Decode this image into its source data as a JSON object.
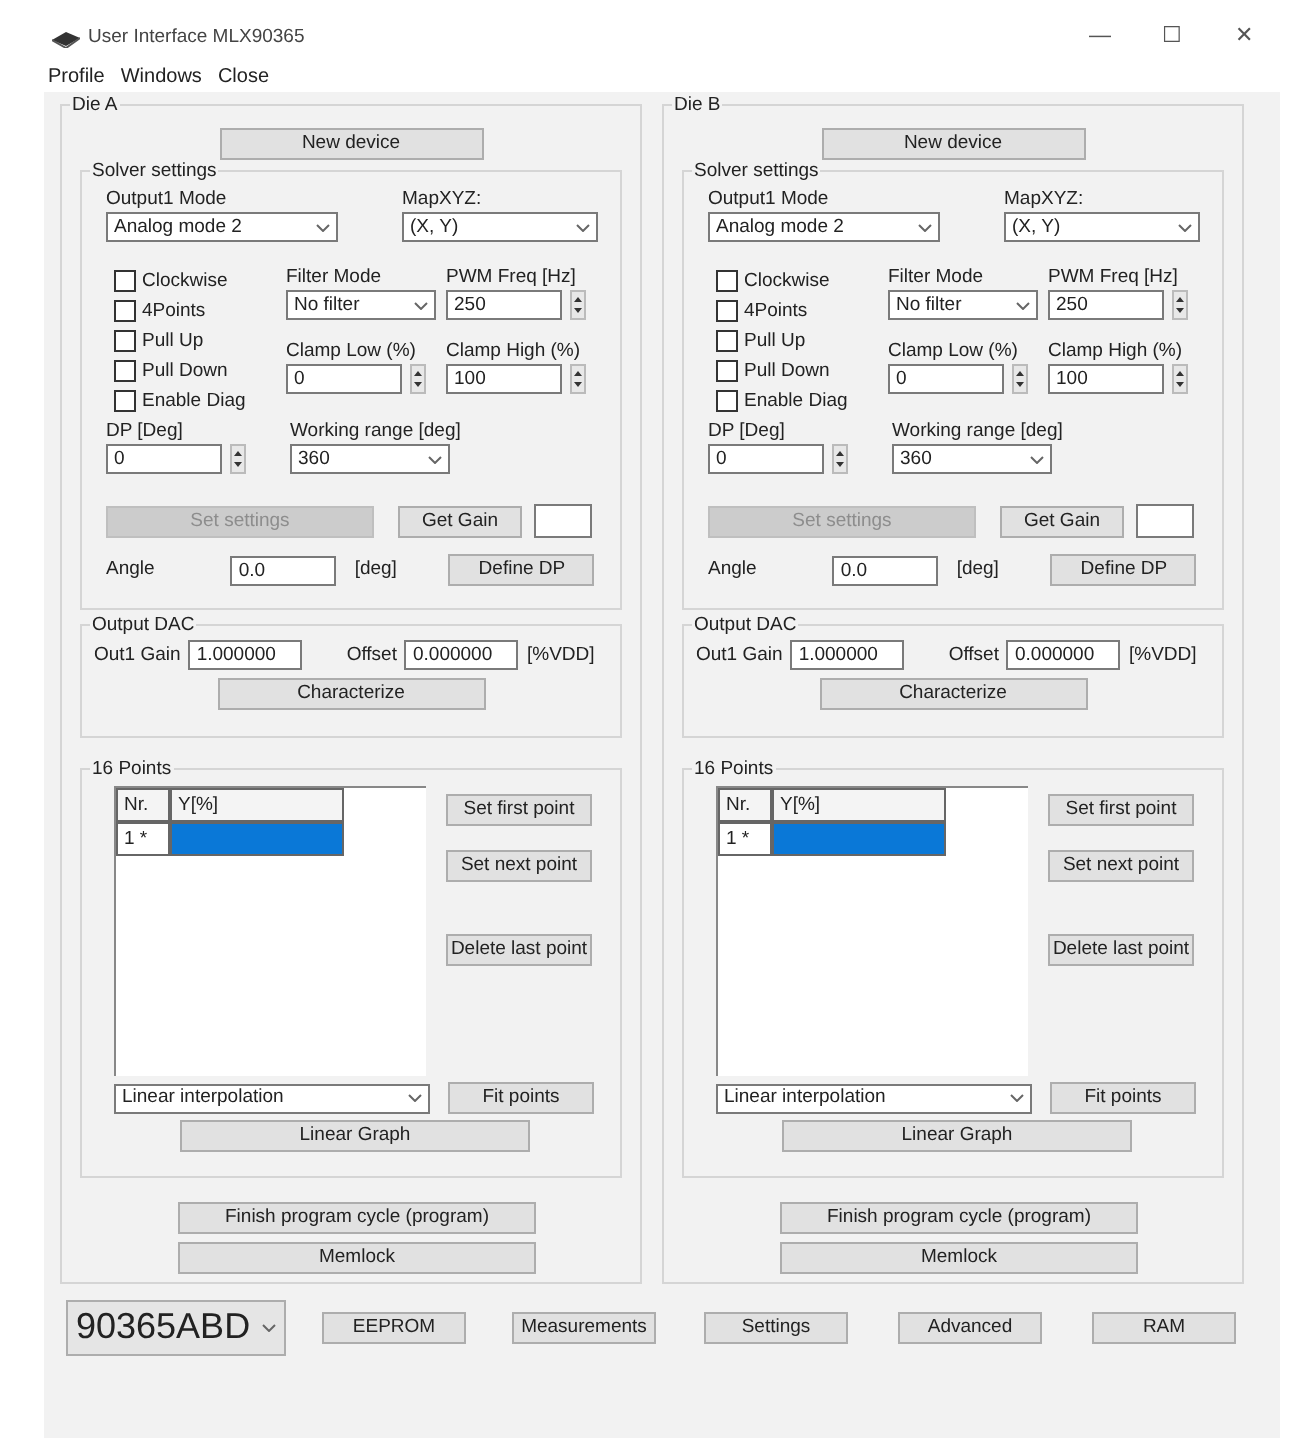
{
  "window": {
    "title": "User Interface MLX90365",
    "controls": [
      "—",
      "☐",
      "✕"
    ]
  },
  "menu": [
    {
      "label": "Profile"
    },
    {
      "label": "Windows"
    },
    {
      "label": "Close"
    }
  ],
  "panels": [
    {
      "title": "Die A",
      "new_device": "New device",
      "solver": {
        "title": "Solver settings",
        "output_mode": {
          "label": "Output1 Mode",
          "value": "Analog mode 2"
        },
        "map": {
          "label": "MapXYZ:",
          "value": "(X, Y)"
        },
        "checkboxes": [
          {
            "label": "Clockwise",
            "checked": false
          },
          {
            "label": "4Points",
            "checked": false
          },
          {
            "label": "Pull Up",
            "checked": false
          },
          {
            "label": "Pull Down",
            "checked": false
          },
          {
            "label": "Enable Diag",
            "checked": false
          }
        ],
        "filter": {
          "label": "Filter Mode",
          "value": "No filter"
        },
        "pwm": {
          "label": "PWM Freq [Hz]",
          "value": "250"
        },
        "clamp_low": {
          "label": "Clamp Low (%)",
          "value": "0"
        },
        "clamp_high": {
          "label": "Clamp High (%)",
          "value": "100"
        },
        "dp": {
          "label": "DP [Deg]",
          "value": "0"
        },
        "working_range": {
          "label": "Working range [deg]",
          "value": "360"
        },
        "set_settings": {
          "label": "Set settings",
          "disabled": true
        },
        "get_gain": "Get Gain",
        "angle": {
          "label": "Angle",
          "value": "0.0",
          "unit": "[deg]"
        },
        "define_dp": "Define DP"
      },
      "output_dac": {
        "title": "Output DAC",
        "gain": {
          "label": "Out1 Gain",
          "value": "1.000000"
        },
        "offset": {
          "label": "Offset",
          "value": "0.000000"
        },
        "unit": "[%VDD]",
        "characterize": "Characterize"
      },
      "points": {
        "title": "16 Points",
        "columns": [
          "Nr.",
          "Y[%]"
        ],
        "rows": [
          {
            "nr": "1 *",
            "selected": true
          }
        ],
        "buttons": [
          "Set first point",
          "Set next point",
          "Delete last point"
        ],
        "interpolation": "Linear interpolation",
        "fit": "Fit points",
        "graph": "Linear Graph"
      },
      "finish": "Finish program cycle (program)",
      "memlock": "Memlock"
    },
    {
      "title": "Die B",
      "new_device": "New device",
      "solver": {
        "title": "Solver settings",
        "output_mode": {
          "label": "Output1 Mode",
          "value": "Analog mode 2"
        },
        "map": {
          "label": "MapXYZ:",
          "value": "(X, Y)"
        },
        "checkboxes": [
          {
            "label": "Clockwise",
            "checked": false
          },
          {
            "label": "4Points",
            "checked": false
          },
          {
            "label": "Pull Up",
            "checked": false
          },
          {
            "label": "Pull Down",
            "checked": false
          },
          {
            "label": "Enable Diag",
            "checked": false
          }
        ],
        "filter": {
          "label": "Filter Mode",
          "value": "No filter"
        },
        "pwm": {
          "label": "PWM Freq [Hz]",
          "value": "250"
        },
        "clamp_low": {
          "label": "Clamp Low (%)",
          "value": "0"
        },
        "clamp_high": {
          "label": "Clamp High (%)",
          "value": "100"
        },
        "dp": {
          "label": "DP [Deg]",
          "value": "0"
        },
        "working_range": {
          "label": "Working range [deg]",
          "value": "360"
        },
        "set_settings": {
          "label": "Set settings",
          "disabled": true
        },
        "get_gain": "Get Gain",
        "angle": {
          "label": "Angle",
          "value": "0.0",
          "unit": "[deg]"
        },
        "define_dp": "Define DP"
      },
      "output_dac": {
        "title": "Output DAC",
        "gain": {
          "label": "Out1 Gain",
          "value": "1.000000"
        },
        "offset": {
          "label": "Offset",
          "value": "0.000000"
        },
        "unit": "[%VDD]",
        "characterize": "Characterize"
      },
      "points": {
        "title": "16 Points",
        "columns": [
          "Nr.",
          "Y[%]"
        ],
        "rows": [
          {
            "nr": "1 *",
            "selected": true
          }
        ],
        "buttons": [
          "Set first point",
          "Set next point",
          "Delete last point"
        ],
        "interpolation": "Linear interpolation",
        "fit": "Fit points",
        "graph": "Linear Graph"
      },
      "finish": "Finish program cycle (program)",
      "memlock": "Memlock"
    }
  ],
  "device": {
    "value": "90365ABD"
  },
  "bottom_buttons": [
    "EEPROM",
    "Measurements",
    "Settings",
    "Advanced",
    "RAM"
  ]
}
